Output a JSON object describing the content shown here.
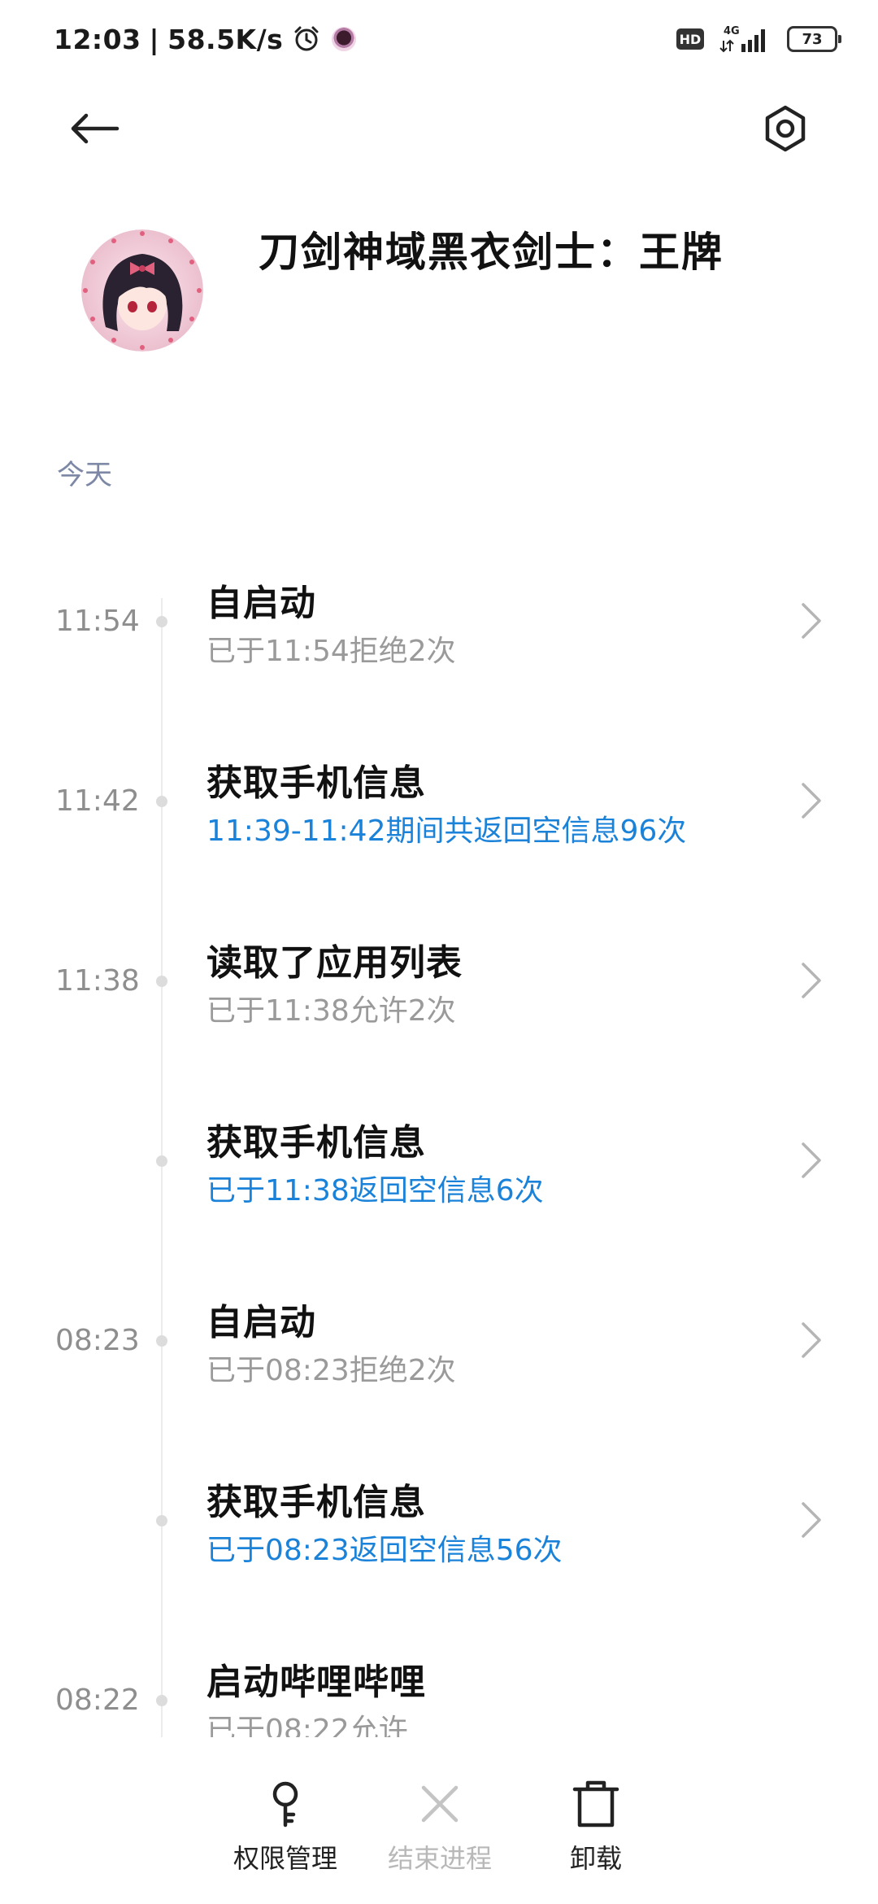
{
  "status_bar": {
    "time": "12:03",
    "separator": "|",
    "net_speed": "58.5K/s",
    "hd_label": "HD",
    "network_label": "4G",
    "battery": "73"
  },
  "header": {
    "back_icon": "back-arrow-icon",
    "settings_icon": "settings-gear-icon",
    "app_name": "刀剑神域黑衣剑士：王牌"
  },
  "section": {
    "label": "今天"
  },
  "timeline": [
    {
      "time": "11:54",
      "title": "自启动",
      "detail": "已于11:54拒绝2次",
      "detail_style": "gray"
    },
    {
      "time": "11:42",
      "title": "获取手机信息",
      "detail": "11:39-11:42期间共返回空信息96次",
      "detail_style": "blue"
    },
    {
      "time": "11:38",
      "title": "读取了应用列表",
      "detail": "已于11:38允许2次",
      "detail_style": "gray"
    },
    {
      "time": "",
      "title": "获取手机信息",
      "detail": "已于11:38返回空信息6次",
      "detail_style": "blue"
    },
    {
      "time": "08:23",
      "title": "自启动",
      "detail": "已于08:23拒绝2次",
      "detail_style": "gray"
    },
    {
      "time": "",
      "title": "获取手机信息",
      "detail": "已于08:23返回空信息56次",
      "detail_style": "blue"
    },
    {
      "time": "08:22",
      "title": "启动哔哩哔哩",
      "detail": "已于08:22允许",
      "detail_style": "gray"
    }
  ],
  "bottom_bar": {
    "permissions_label": "权限管理",
    "end_process_label": "结束进程",
    "uninstall_label": "卸载"
  },
  "colors": {
    "accent_blue": "#1a82d9",
    "section_label": "#7c88a6",
    "secondary_gray": "#9a9a9a"
  }
}
